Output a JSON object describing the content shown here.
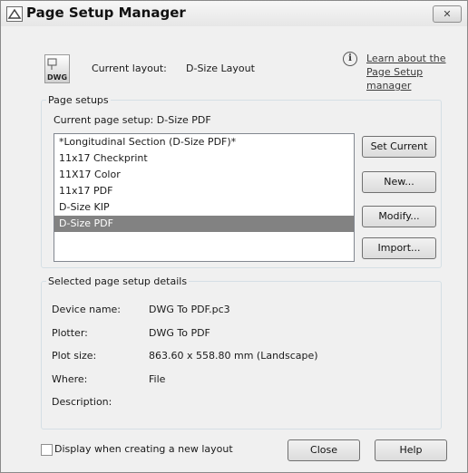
{
  "window": {
    "title": "Page Setup Manager",
    "close_glyph": "✕"
  },
  "layout": {
    "icon_label": "DWG",
    "current_layout_label": "Current layout:",
    "current_layout_value": "D-Size Layout"
  },
  "help_link": {
    "icon_glyph": "i",
    "text": "Learn about the Page Setup manager"
  },
  "page_setups": {
    "legend": "Page setups",
    "current_label": "Current page setup:",
    "current_value": "D-Size PDF",
    "items": [
      "*Longitudinal Section (D-Size PDF)*",
      "11x17 Checkprint",
      "11X17 Color",
      "11x17 PDF",
      "D-Size KIP",
      "D-Size PDF"
    ],
    "selected_item": "D-Size PDF"
  },
  "buttons": {
    "set_current": "Set Current",
    "new": "New...",
    "modify": "Modify...",
    "import": "Import...",
    "close": "Close",
    "help": "Help"
  },
  "details": {
    "legend": "Selected page setup details",
    "device_name_label": "Device name:",
    "device_name_value": "DWG To PDF.pc3",
    "plotter_label": "Plotter:",
    "plotter_value": "DWG To PDF",
    "plot_size_label": "Plot size:",
    "plot_size_value": "863.60 x 558.80 mm (Landscape)",
    "where_label": "Where:",
    "where_value": "File",
    "description_label": "Description:",
    "description_value": ""
  },
  "footer": {
    "checkbox_label": "Display when creating a new layout",
    "checkbox_checked": false
  }
}
